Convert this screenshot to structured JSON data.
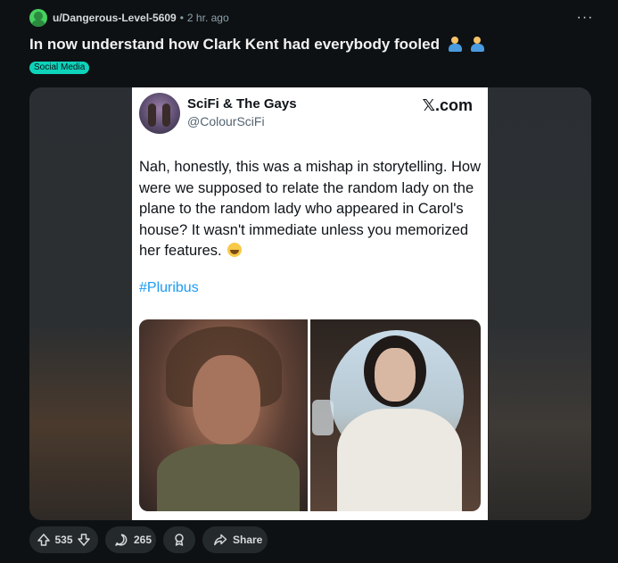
{
  "post": {
    "username": "u/Dangerous-Level-5609",
    "separator": "•",
    "time": "2 hr. ago",
    "title": "In now understand how Clark Kent had everybody fooled",
    "flair": "Social Media",
    "more_label": "···"
  },
  "tweet": {
    "name": "SciFi & The Gays",
    "handle": "@ColourSciFi",
    "brand": "𝕏.com",
    "body": "Nah, honestly, this was a mishap in storytelling. How were we supposed to relate the random lady on the plane to the random lady who appeared in Carol's house? It wasn't immediate unless you memorized her features.",
    "hashtag": "#Pluribus"
  },
  "actions": {
    "upvotes": "535",
    "comments": "265",
    "share_label": "Share"
  },
  "colors": {
    "background": "#0e1113",
    "flair": "#0dd3bb",
    "pill": "#24292c",
    "hashtag": "#1d9bf0"
  },
  "icons": [
    "avatar",
    "more-icon",
    "person-facepalming-emoji",
    "face-with-tears-of-joy-emoji",
    "upvote-icon",
    "downvote-icon",
    "comment-icon",
    "award-icon",
    "share-icon"
  ]
}
